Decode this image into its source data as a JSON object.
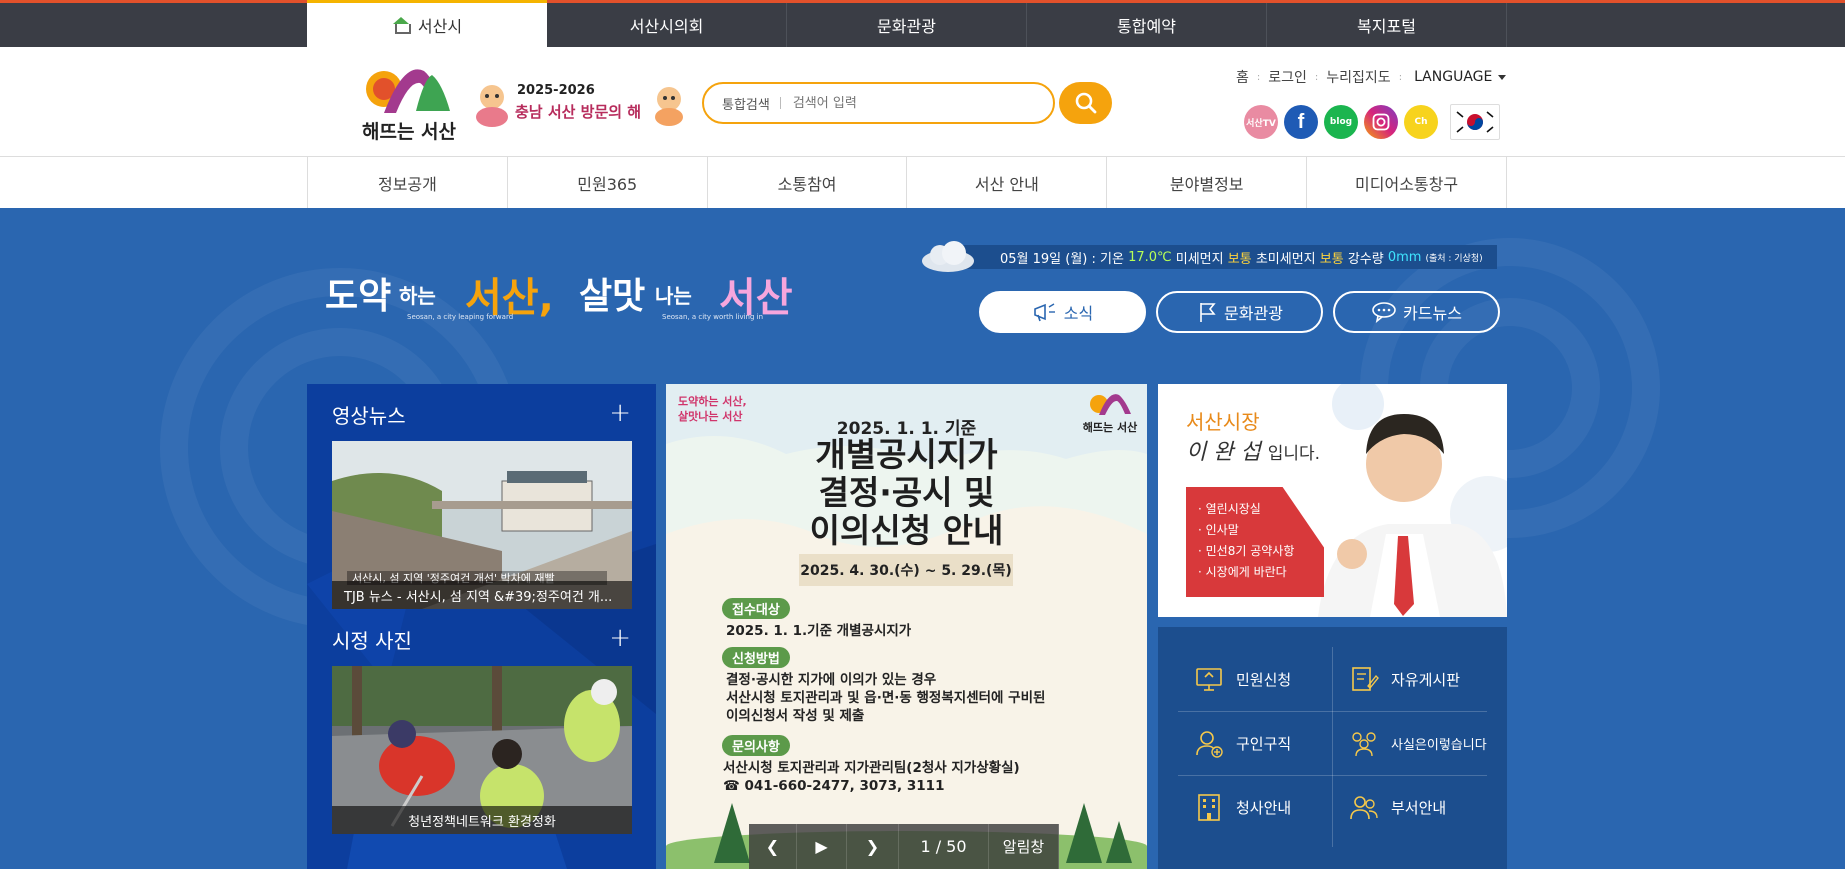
{
  "top_tabs": [
    "서산시",
    "서산시의회",
    "문화관광",
    "통합예약",
    "복지포털"
  ],
  "logo": {
    "text": "해뜨는 서산"
  },
  "visit_banner": {
    "year": "2025-2026",
    "text": "충남 서산 방문의 해"
  },
  "search": {
    "label": "통합검색",
    "placeholder": "검색어 입력"
  },
  "util_links": [
    "홈",
    "로그인",
    "누리집지도",
    "LANGUAGE"
  ],
  "sns": [
    "seosan-tv-icon",
    "facebook-icon",
    "blog-icon",
    "instagram-icon",
    "kakao-channel-icon",
    "korea-flag-icon"
  ],
  "sns_labels": {
    "tv": "서산TV",
    "blog": "blog",
    "channel": "Ch"
  },
  "gnb": [
    "정보공개",
    "민원365",
    "소통참여",
    "서산 안내",
    "분야별정보",
    "미디어소통창구"
  ],
  "slogan": {
    "part1": "도약",
    "part1b": "하는",
    "part2": "서산,",
    "part3": "살맛",
    "part3b": "나는",
    "part4": "서산",
    "sub1": "Seosan, a city leaping forward",
    "sub2": "Seosan, a city worth living in"
  },
  "weather": {
    "date": "05월 19일 (월) : 기온",
    "temp": "17.0℃",
    "pm10_label": "미세먼지",
    "pm10": "보통",
    "pm25_label": "초미세먼지",
    "pm25": "보통",
    "rain_label": "강수량",
    "rain": "0mm",
    "source": "(출처 : 기상청)"
  },
  "pills": [
    "소식",
    "문화관광",
    "카드뉴스"
  ],
  "video_news": {
    "title": "영상뉴스",
    "plus": "+",
    "caption": "TJB 뉴스 - 서산시, 섬 지역 &#39;정주여건 개...",
    "overlay": "서산시, 섬 지역 '정주여건 개선' 박차에 재빨"
  },
  "city_photo": {
    "title": "시정 사진",
    "plus": "+",
    "caption": "청년정책네트워크 환경정화"
  },
  "notice": {
    "slogan1": "도약하는 서산,",
    "slogan2": "살맛나는 서산",
    "logo_text": "해뜨는 서산",
    "date": "2025. 1. 1. 기준",
    "title1": "개별공시지가",
    "title2": "결정·공시 및",
    "title3": "이의신청 안내",
    "period": "2025. 4. 30.(수) ~ 5. 29.(목)",
    "tag1": "접수대상",
    "text1": "2025. 1. 1.기준 개별공시지가",
    "tag2": "신청방법",
    "text2a": "결정·공시한 지가에 이의가 있는 경우",
    "text2b": "서산시청 토지관리과 및 읍·면·동 행정복지센터에 구비된",
    "text2c": "이의신청서 작성 및 제출",
    "tag3": "문의사항",
    "text3a": "서산시청 토지관리과 지가관리팀(2청사 지가상황실)",
    "text3b": "☎ 041-660-2477, 3073, 3111",
    "counter": "1 / 50",
    "board": "알림창"
  },
  "mayor": {
    "title": "서산시장",
    "name": "이 완 섭",
    "suffix": "입니다.",
    "links": [
      "· 열린시장실",
      "· 인사말",
      "· 민선8기 공약사항",
      "· 시장에게 바란다"
    ]
  },
  "quick_menu": [
    "민원신청",
    "자유게시판",
    "구인구직",
    "사실은이렇습니다",
    "청사안내",
    "부서안내"
  ],
  "colors": {
    "main_bg": "#2a66b0",
    "accent_orange": "#f5a30d",
    "tab_dark": "#3a3d45",
    "news_panel": "#0c3e9e"
  }
}
